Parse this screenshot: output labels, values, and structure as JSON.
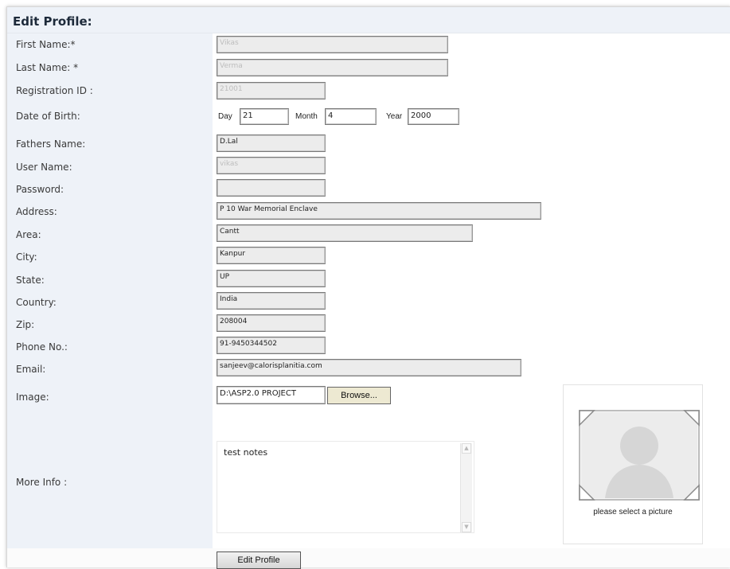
{
  "header": {
    "title": "Edit Profile:"
  },
  "fields": {
    "first_name": {
      "label": "First Name:*",
      "value": "Vikas"
    },
    "last_name": {
      "label": "Last Name: *",
      "value": "Verma"
    },
    "registration_id": {
      "label": "Registration ID :",
      "value": "21001"
    },
    "dob": {
      "label": "Date of Birth:",
      "day_label": "Day",
      "day": "21",
      "month_label": "Month",
      "month": "4",
      "year_label": "Year",
      "year": "2000"
    },
    "fathers_name": {
      "label": "Fathers Name:",
      "value": "D.Lal"
    },
    "user_name": {
      "label": "User Name:",
      "value": "vikas"
    },
    "password": {
      "label": "Password:",
      "value": ""
    },
    "address": {
      "label": "Address:",
      "value": "P 10 War Memorial Enclave"
    },
    "area": {
      "label": "Area:",
      "value": "Cantt"
    },
    "city": {
      "label": "City:",
      "value": "Kanpur"
    },
    "state": {
      "label": "State:",
      "value": "UP"
    },
    "country": {
      "label": "Country:",
      "value": "India"
    },
    "zip": {
      "label": "Zip:",
      "value": "208004"
    },
    "phone": {
      "label": "Phone No.:",
      "value": "91-9450344502"
    },
    "email": {
      "label": "Email:",
      "value": "sanjeev@calorisplanitia.com"
    },
    "image": {
      "label": "Image:",
      "value": "D:\\ASP2.0 PROJECT",
      "browse_label": "Browse..."
    },
    "more_info": {
      "label": "More Info :",
      "value": "test notes"
    }
  },
  "picture": {
    "caption": "please select a picture",
    "icon": "avatar-placeholder-icon"
  },
  "actions": {
    "submit_label": "Edit Profile"
  },
  "colors": {
    "label_column_bg": "#eef2f8",
    "input_bg": "#ececec",
    "title_text": "#1d2a3a"
  }
}
